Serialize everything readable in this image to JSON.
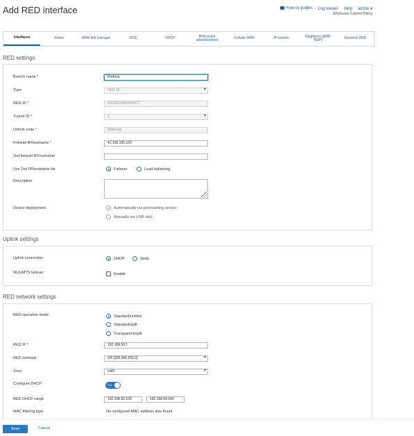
{
  "page": {
    "title": "Add RED interface"
  },
  "topnav": {
    "howto": "How-to guides",
    "logviewer": "Log viewer",
    "help": "Help",
    "admin": "admin ▾",
    "company": "Wholesale Cabinet Fitting"
  },
  "tabs": [
    "Interfaces",
    "Zones",
    "WAN link manager",
    "DNS",
    "DHCP",
    "IPv6 router advertisement",
    "Cellular WAN",
    "IP tunnels",
    "Neighbors (ARP-NDP)",
    "Dynamic DNS"
  ],
  "red_settings": {
    "title": "RED settings",
    "branch_name": {
      "label": "Branch name *",
      "value": "Pretoria"
    },
    "type": {
      "label": "Type",
      "value": "RED 15"
    },
    "red_id": {
      "label": "RED ID *",
      "value": "A35023394073A3C7"
    },
    "tunnel_id": {
      "label": "Tunnel ID *",
      "value": "1"
    },
    "unlock_code": {
      "label": "Unlock code *",
      "value": "8pld2ssq"
    },
    "firewall_ip": {
      "label": "Firewall IP/hostname *",
      "value": "41.160.105.163"
    },
    "second_firewall": {
      "label": "2nd firewall IP/hostname",
      "value": ""
    },
    "use_second": {
      "label": "Use 2nd IP/hostname for",
      "opt1": "Failover",
      "opt2": "Load balancing"
    },
    "description": {
      "label": "Description"
    },
    "deployment": {
      "label": "Device deployment",
      "opt1": "Automatically via provisioning service",
      "opt2": "Manually via USB stick"
    }
  },
  "uplink_settings": {
    "title": "Uplink settings",
    "connection": {
      "label": "Uplink connection",
      "opt1": "DHCP",
      "opt2": "Static"
    },
    "failover": {
      "label": "3G/UMTS failover",
      "enable": "Enable"
    }
  },
  "network_settings": {
    "title": "RED network settings",
    "mode": {
      "label": "RED operation mode",
      "opt1": "Standard/unified",
      "opt2": "Standard/split",
      "opt3": "Transparent/split"
    },
    "red_ip": {
      "label": "RED IP *",
      "value": "192.168.50.1"
    },
    "netmask": {
      "label": "RED netmask",
      "value": "/24 (255.255.255.0)"
    },
    "zone": {
      "label": "Zone",
      "value": "LAN"
    },
    "configure_dhcp": {
      "label": "Configure DHCP",
      "toggle": "ON"
    },
    "dhcp_range": {
      "label": "RED DHCP range",
      "start": "192.168.50.100",
      "end": "192.168.50.200"
    },
    "mac_filtering": {
      "label": "MAC filtering type",
      "value": "No configured MAC address lists found"
    }
  },
  "footer": {
    "save": "Save",
    "cancel": "Cancel"
  }
}
